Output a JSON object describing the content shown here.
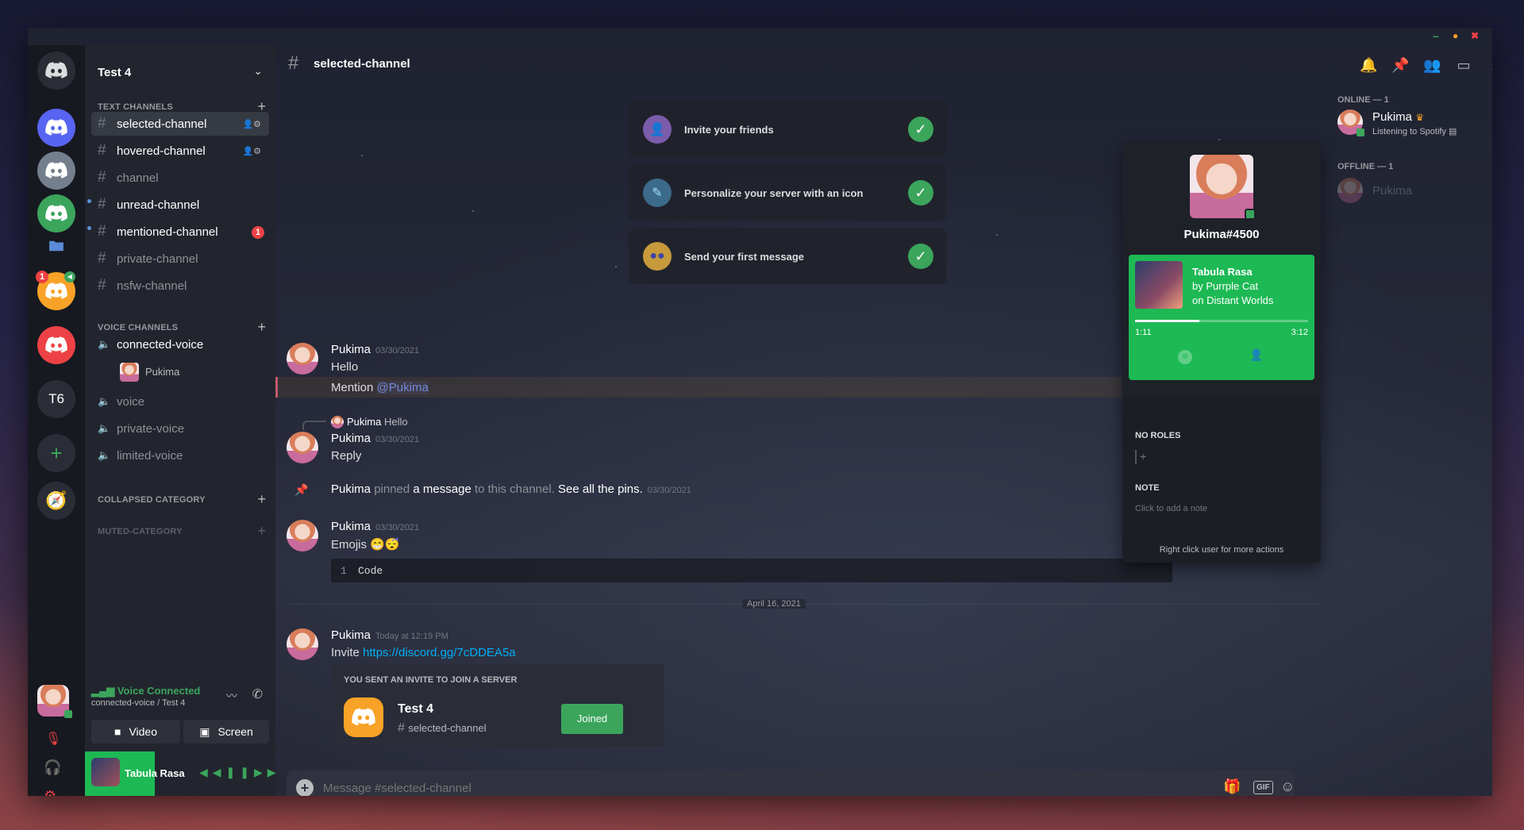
{
  "window": {
    "minimize": "–",
    "maximize": "●",
    "close": "✖"
  },
  "colors": {
    "accent": "#5865f2",
    "green": "#3ba55c",
    "spotify": "#1db954",
    "red": "#ed4245",
    "orange": "#f8a227",
    "link": "#00aff4"
  },
  "rail": {
    "badge_count": "1",
    "server_initials": "T6"
  },
  "guild": {
    "name": "Test 4"
  },
  "categories": {
    "text": "TEXT CHANNELS",
    "voice": "VOICE CHANNELS",
    "collapsed": "COLLAPSED CATEGORY",
    "muted": "MUTED-CATEGORY"
  },
  "text_channels": [
    {
      "name": "selected-channel"
    },
    {
      "name": "hovered-channel"
    },
    {
      "name": "channel"
    },
    {
      "name": "unread-channel"
    },
    {
      "name": "mentioned-channel",
      "mentions": "1"
    },
    {
      "name": "private-channel"
    },
    {
      "name": "nsfw-channel"
    }
  ],
  "voice_channels": [
    {
      "name": "connected-voice"
    },
    {
      "name": "voice"
    },
    {
      "name": "private-voice"
    },
    {
      "name": "limited-voice"
    }
  ],
  "voice_user": "Pukima",
  "voice_status": {
    "title": "Voice Connected",
    "subtitle": "connected-voice / Test 4"
  },
  "voice_buttons": {
    "video": "Video",
    "screen": "Screen"
  },
  "now_playing": {
    "track": "Tabula Rasa"
  },
  "header": {
    "channel": "selected-channel"
  },
  "welcome": [
    {
      "text": "Invite your friends"
    },
    {
      "text": "Personalize your server with an icon"
    },
    {
      "text": "Send your first message"
    }
  ],
  "messages": {
    "m1": {
      "author": "Pukima",
      "timestamp": "03/30/2021",
      "line1": "Hello",
      "line2_prefix": "Mention ",
      "mention": "@Pukima"
    },
    "m2": {
      "reply_author": "Pukima",
      "reply_text": "Hello",
      "author": "Pukima",
      "timestamp": "03/30/2021",
      "text": "Reply"
    },
    "pin": {
      "author": "Pukima",
      "pinned": " pinned ",
      "a_message": "a message",
      "to_channel": " to this channel. ",
      "see_pins": "See all the pins.",
      "timestamp": "03/30/2021"
    },
    "m3": {
      "author": "Pukima",
      "timestamp": "03/30/2021",
      "text": "Emojis",
      "code_line": "1",
      "code": "Code"
    },
    "date_divider": "April 16, 2021",
    "m4": {
      "author": "Pukima",
      "timestamp": "Today at 12:19 PM",
      "prefix": "Invite ",
      "link": "https://discord.gg/7cDDEA5a"
    },
    "invite": {
      "heading": "YOU SENT AN INVITE TO JOIN A SERVER",
      "server": "Test 4",
      "channel": "selected-channel",
      "button": "Joined"
    }
  },
  "composer": {
    "placeholder": "Message #selected-channel",
    "gif": "GIF"
  },
  "popout": {
    "username": "Pukima#4500",
    "track": "Tabula Rasa",
    "artist": "by Purrple Cat",
    "album": "on Distant Worlds",
    "elapsed": "1:11",
    "duration": "3:12",
    "progress": 0.37,
    "roles_heading": "NO ROLES",
    "note_heading": "NOTE",
    "note_placeholder": "Click to add a note",
    "hint": "Right click user for more actions"
  },
  "members": {
    "online_heading": "ONLINE — 1",
    "offline_heading": "OFFLINE — 1",
    "online": [
      {
        "name": "Pukima",
        "activity": "Listening to Spotify"
      }
    ],
    "offline": [
      {
        "name": "Pukima"
      }
    ]
  }
}
